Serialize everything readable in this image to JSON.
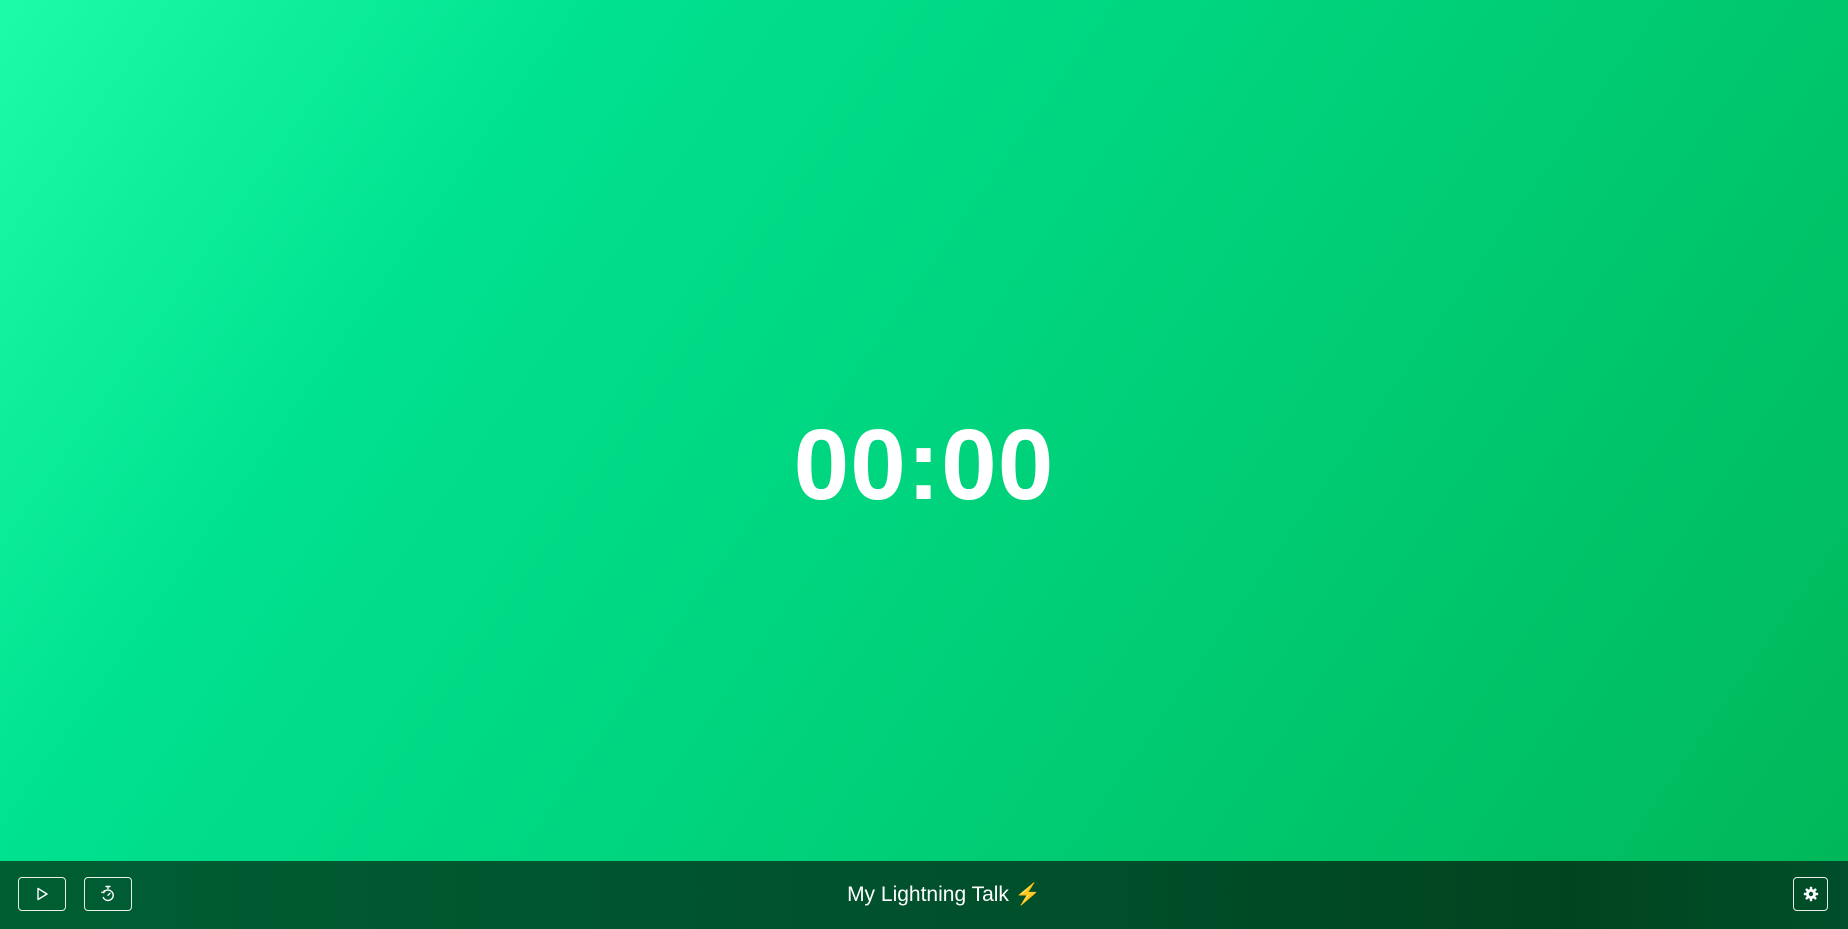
{
  "timer": {
    "display": "00:00"
  },
  "toolbar": {
    "talk_title": "My Lightning Talk",
    "title_emoji": "⚡",
    "buttons": [
      {
        "name": "play-button",
        "icon": "play-icon"
      },
      {
        "name": "reset-timer-button",
        "icon": "timer-reset-icon"
      },
      {
        "name": "settings-button",
        "icon": "gear-icon"
      }
    ]
  },
  "colors": {
    "background_gradient_start": "#1dfca6",
    "background_gradient_end": "#00b85a",
    "toolbar_background": "#004e2a",
    "text": "#ffffff"
  }
}
